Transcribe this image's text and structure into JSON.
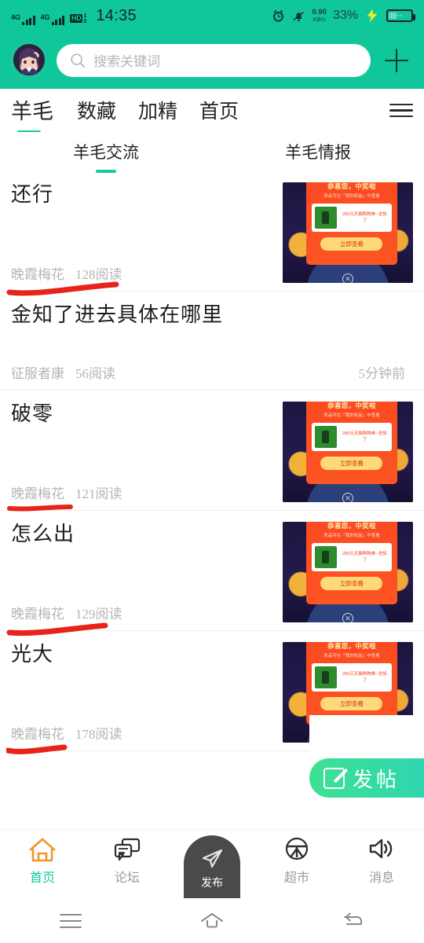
{
  "statusbar": {
    "signal1": "4G",
    "signal2": "4G",
    "hd_label": "HD",
    "hd_sub1": "1",
    "hd_sub2": "2",
    "time": "14:35",
    "alarm_icon": "alarm-clock-icon",
    "mute_icon": "bell-muted-icon",
    "net_speed_value": "0.90",
    "net_speed_unit": "KB/s",
    "battery_percent": "33%",
    "charging_icon": "lightning-bolt-icon"
  },
  "header": {
    "avatar_name": "user-avatar",
    "search_placeholder": "搜索关键词",
    "search_icon": "search-icon",
    "add_icon": "plus-icon"
  },
  "tabs": {
    "items": [
      {
        "label": "羊毛",
        "active": true
      },
      {
        "label": "数藏",
        "active": false
      },
      {
        "label": "加精",
        "active": false
      },
      {
        "label": "首页",
        "active": false
      }
    ],
    "menu_icon": "hamburger-menu-icon"
  },
  "subtabs": {
    "items": [
      {
        "label": "羊毛交流",
        "active": true
      },
      {
        "label": "羊毛情报",
        "active": false
      }
    ]
  },
  "ad": {
    "headline": "恭喜您，中奖啦",
    "subline": "来品可在「我的权益」中查看",
    "copy": "200元天猫购物券--全知了",
    "button": "立即查看",
    "close_icon": "close-circle-icon"
  },
  "feed": {
    "posts": [
      {
        "title": "还行",
        "author": "晚霞梅花",
        "reads": "128阅读",
        "time": "",
        "has_thumb": true,
        "annotated": true
      },
      {
        "title": "金知了进去具体在哪里",
        "author": "征服者康",
        "reads": "56阅读",
        "time": "5分钟前",
        "has_thumb": false,
        "annotated": false
      },
      {
        "title": "破零",
        "author": "晚霞梅花",
        "reads": "121阅读",
        "time": "",
        "has_thumb": true,
        "annotated": true
      },
      {
        "title": "怎么出",
        "author": "晚霞梅花",
        "reads": "129阅读",
        "time": "",
        "has_thumb": true,
        "annotated": true
      },
      {
        "title": "光大",
        "author": "晚霞梅花",
        "reads": "178阅读",
        "time": "",
        "has_thumb": true,
        "annotated": true
      }
    ]
  },
  "fab": {
    "label": "发帖",
    "icon": "compose-pencil-icon"
  },
  "bottomnav": {
    "items": [
      {
        "label": "首页",
        "icon": "home-icon",
        "active": true
      },
      {
        "label": "论坛",
        "icon": "chat-bubbles-icon",
        "active": false
      },
      {
        "label": "发布",
        "icon": "paper-plane-icon",
        "active": false
      },
      {
        "label": "超市",
        "icon": "store-icon",
        "active": false
      },
      {
        "label": "消息",
        "icon": "speaker-icon",
        "active": false
      }
    ]
  },
  "sysnav": {
    "menu_icon": "system-menu-icon",
    "home_icon": "system-home-icon",
    "back_icon": "system-back-icon"
  },
  "colors": {
    "brand_green": "#0FC79B",
    "accent_green": "#17C9A0",
    "annotation_red": "#E8231C",
    "ad_red": "#FB4A20",
    "home_orange": "#F0952E"
  }
}
